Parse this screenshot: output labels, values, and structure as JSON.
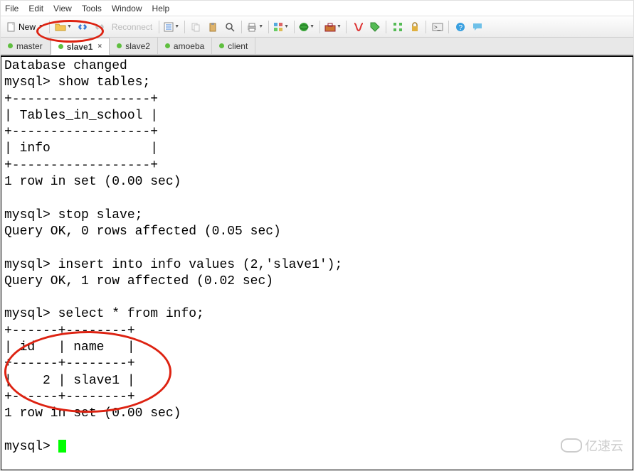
{
  "menu": {
    "items": [
      "File",
      "Edit",
      "View",
      "Tools",
      "Window",
      "Help"
    ]
  },
  "toolbar": {
    "new_label": "New",
    "reconnect_label": "Reconnect"
  },
  "tabs": [
    {
      "label": "master",
      "active": false,
      "closable": false
    },
    {
      "label": "slave1",
      "active": true,
      "closable": true
    },
    {
      "label": "slave2",
      "active": false,
      "closable": false
    },
    {
      "label": "amoeba",
      "active": false,
      "closable": false
    },
    {
      "label": "client",
      "active": false,
      "closable": false
    }
  ],
  "terminal_lines": [
    "Database changed",
    "mysql> show tables;",
    "+------------------+",
    "| Tables_in_school |",
    "+------------------+",
    "| info             |",
    "+------------------+",
    "1 row in set (0.00 sec)",
    "",
    "mysql> stop slave;",
    "Query OK, 0 rows affected (0.05 sec)",
    "",
    "mysql> insert into info values (2,'slave1');",
    "Query OK, 1 row affected (0.02 sec)",
    "",
    "mysql> select * from info;",
    "+------+--------+",
    "| id   | name   |",
    "+------+--------+",
    "|    2 | slave1 |",
    "+------+--------+",
    "1 row in set (0.00 sec)",
    "",
    "mysql> "
  ],
  "watermark_text": "亿速云"
}
